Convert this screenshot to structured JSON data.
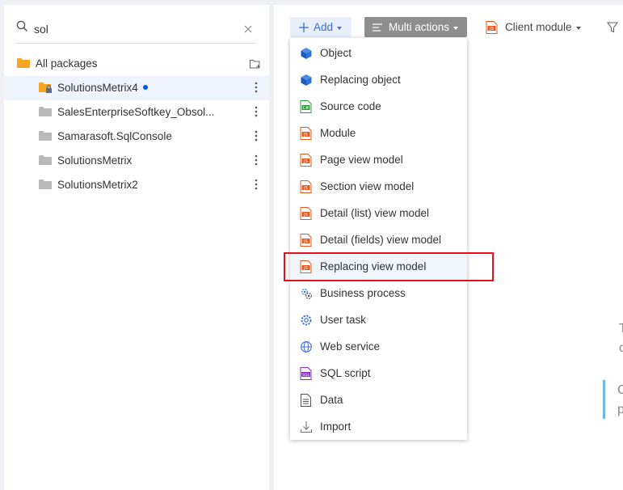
{
  "search": {
    "value": "sol",
    "placeholder": ""
  },
  "tree": {
    "root_label": "All packages",
    "packages": [
      {
        "label": "SolutionsMetrix4",
        "selected": true,
        "modified": true,
        "locked": true
      },
      {
        "label": "SalesEnterpriseSoftkey_Obsol...",
        "selected": false
      },
      {
        "label": "Samarasoft.SqlConsole",
        "selected": false
      },
      {
        "label": "SolutionsMetrix",
        "selected": false
      },
      {
        "label": "SolutionsMetrix2",
        "selected": false
      }
    ]
  },
  "toolbar": {
    "add_label": "Add",
    "multi_label": "Multi actions",
    "client_module_label": "Client module"
  },
  "add_menu": {
    "items": [
      {
        "label": "Object",
        "icon": "cube-icon"
      },
      {
        "label": "Replacing object",
        "icon": "cube-icon"
      },
      {
        "label": "Source code",
        "icon": "source-code-icon"
      },
      {
        "label": "Module",
        "icon": "js-file-icon"
      },
      {
        "label": "Page view model",
        "icon": "js-file-icon"
      },
      {
        "label": "Section view model",
        "icon": "js-file-icon"
      },
      {
        "label": "Detail (list) view model",
        "icon": "js-file-icon"
      },
      {
        "label": "Detail (fields) view model",
        "icon": "js-file-icon"
      },
      {
        "label": "Replacing view model",
        "icon": "js-file-icon"
      },
      {
        "label": "Business process",
        "icon": "gears-icon"
      },
      {
        "label": "User task",
        "icon": "gear-icon"
      },
      {
        "label": "Web service",
        "icon": "globe-icon"
      },
      {
        "label": "SQL script",
        "icon": "sql-file-icon"
      },
      {
        "label": "Data",
        "icon": "document-icon"
      },
      {
        "label": "Import",
        "icon": "import-icon"
      }
    ],
    "hovered_index": 8
  },
  "background_fragments": {
    "t1": "T",
    "t2": "c",
    "t3": "C",
    "t4": "p"
  },
  "colors": {
    "accent": "#0058ef",
    "folder": "#f5a623",
    "folder_gray": "#b9b9b9",
    "js_orange": "#e8581c",
    "highlight": "#e8101c"
  }
}
